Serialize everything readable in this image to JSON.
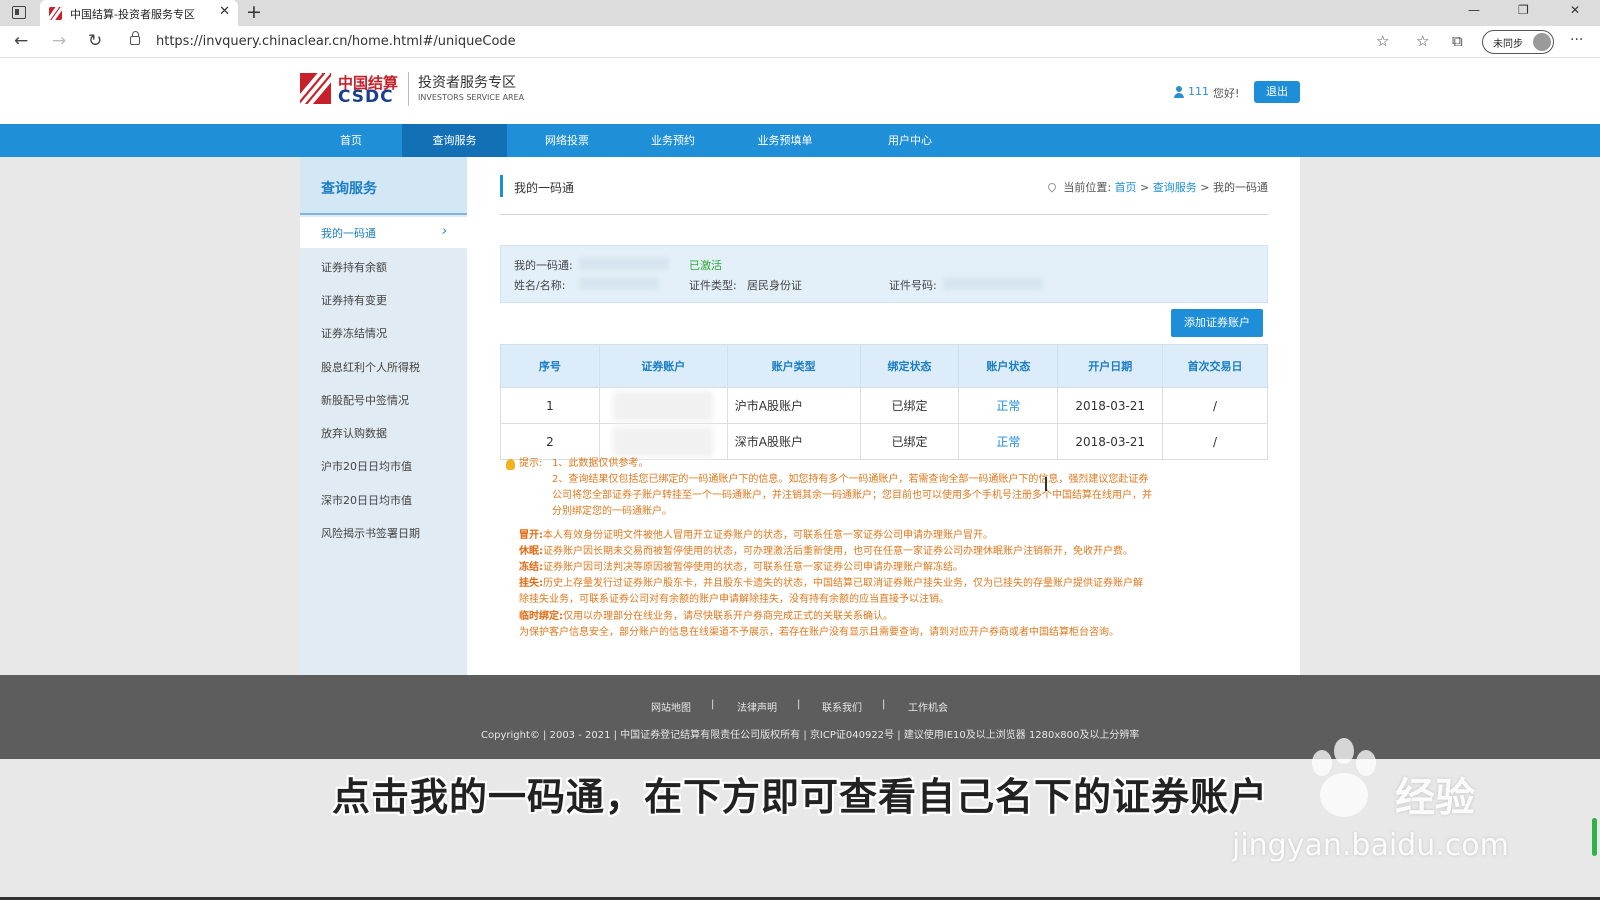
{
  "browser": {
    "tab_title": "中国结算-投资者服务专区",
    "tab_close": "✕",
    "new_tab": "+",
    "url": "https://invquery.chinaclear.cn/home.html#/uniqueCode",
    "sync_label": "未同步",
    "minimize": "—",
    "restore": "❐",
    "close": "✕",
    "back": "←",
    "forward": "→",
    "reload": "↻",
    "more": "···"
  },
  "header": {
    "logo_cn": "中国结算",
    "logo_en": "CSDC",
    "site_title": "投资者服务专区",
    "site_subtitle": "INVESTORS SERVICE AREA",
    "user_name": "111",
    "greeting": "您好!",
    "logout": "退出"
  },
  "nav": [
    "首页",
    "查询服务",
    "网络投票",
    "业务预约",
    "业务预填单",
    "用户中心"
  ],
  "sidebar": {
    "title": "查询服务",
    "items": [
      "我的一码通",
      "证券持有余额",
      "证券持有变更",
      "证券冻结情况",
      "股息红利个人所得税",
      "新股配号中签情况",
      "放弃认购数据",
      "沪市20日日均市值",
      "深市20日日均市值",
      "风险揭示书签署日期"
    ],
    "chevron": "›"
  },
  "content": {
    "title": "我的一码通",
    "breadcrumb": {
      "prefix": "当前位置:",
      "home": "首页",
      "sep": ">",
      "section": "查询服务",
      "current": "我的一码通"
    },
    "info": {
      "code_label": "我的一码通:",
      "code_status": "已激活",
      "name_label": "姓名/名称:",
      "id_type_label": "证件类型:",
      "id_type_value": "居民身份证",
      "id_no_label": "证件号码:"
    },
    "add_button": "添加证券账户",
    "table": {
      "headers": [
        "序号",
        "证券账户",
        "账户类型",
        "绑定状态",
        "账户状态",
        "开户日期",
        "首次交易日"
      ],
      "rows": [
        {
          "no": "1",
          "type": "沪市A股账户",
          "bind": "已绑定",
          "status": "正常",
          "open_date": "2018-03-21",
          "first_trade": "/"
        },
        {
          "no": "2",
          "type": "深市A股账户",
          "bind": "已绑定",
          "status": "正常",
          "open_date": "2018-03-21",
          "first_trade": "/"
        }
      ]
    },
    "notes": {
      "tip_label": "提示:",
      "tip1": "1、此数据仅供参考。",
      "tip2_l1": "2、查询结果仅包括您已绑定的一码通账户下的信息。如您持有多个一码通账户，若需查询全部一码通账户下的信息，强烈建议您赴证券",
      "tip2_l2": "公司将您全部证券子账户转挂至一个一码通账户，并注销其余一码通账户；您目前也可以使用多个手机号注册多个中国结算在线用户，并",
      "tip2_l3": "分别绑定您的一码通账户。",
      "mao_label": "冒开:",
      "mao": "本人有效身份证明文件被他人冒用开立证券账户的状态，可联系任意一家证券公司申请办理账户冒开。",
      "xm_label": "休眠:",
      "xm": "证券账户因长期未交易而被暂停使用的状态，可办理激活后重新使用，也可在任意一家证券公司办理休眠账户注销新开，免收开户费。",
      "dj_label": "冻结:",
      "dj": "证券账户因司法判决等原因被暂停使用的状态，可联系任意一家证券公司申请办理账户解冻结。",
      "gs_label": "挂失:",
      "gs_l1": "历史上存量发行过证券账户股东卡，并且股东卡遗失的状态，中国结算已取消证券账户挂失业务，仅为已挂失的存量账户提供证券账户解",
      "gs_l2": "除挂失业务，可联系证券公司对有余额的账户申请解除挂失，没有持有余额的应当直接予以注销。",
      "ls_label": "临时绑定:",
      "ls": "仅用以办理部分在线业务，请尽快联系开户券商完成正式的关联关系确认。",
      "privacy": "为保护客户信息安全，部分账户的信息在线渠道不予展示，若存在账户没有显示且需要查询，请到对应开户券商或者中国结算柜台咨询。"
    }
  },
  "footer": {
    "links": [
      "网站地图",
      "法律声明",
      "联系我们",
      "工作机会"
    ],
    "sep": "|",
    "copyright": "Copyright© | 2003 - 2021 | 中国证券登记结算有限责任公司版权所有 | 京ICP证040922号 | 建议使用IE10及以上浏览器 1280x800及以上分辨率"
  },
  "overlay": {
    "subtitle": "点击我的一码通，在下方即可查看自己名下的证券账户",
    "watermark_brand": "经验",
    "watermark_url": "jingyan.baidu.com"
  },
  "colors": {
    "accent": "#1f8fd8",
    "nav_active": "#1370b4",
    "brand_red": "#c8202a",
    "note_orange": "#e0781e",
    "status_green": "#2ea836"
  }
}
